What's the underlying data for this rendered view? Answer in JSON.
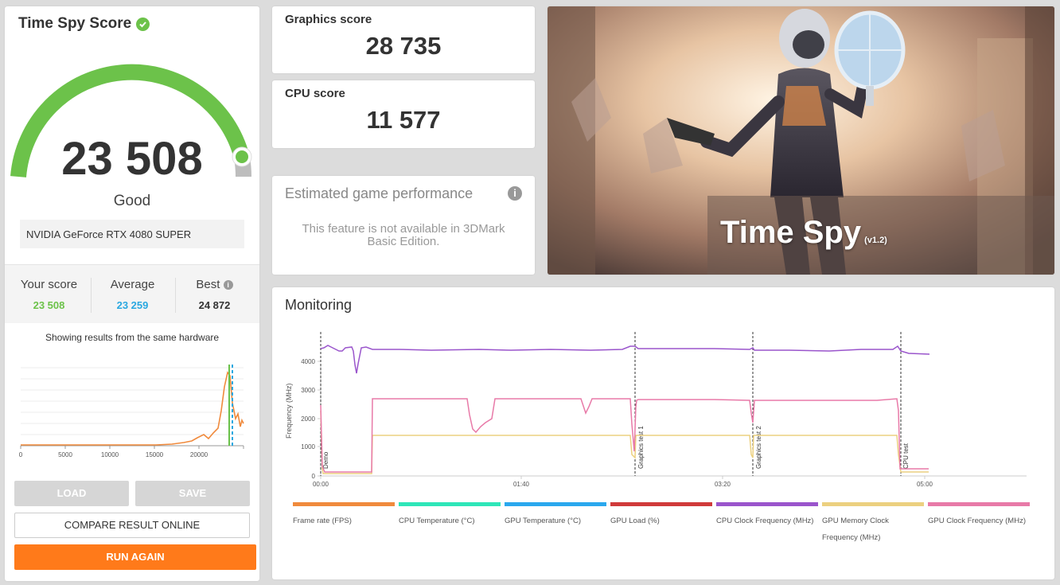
{
  "score_panel": {
    "title": "Time Spy Score",
    "overall_score": "23 508",
    "rating": "Good",
    "gpu_name": "NVIDIA GeForce RTX 4080 SUPER",
    "your_score_label": "Your score",
    "your_score": "23 508",
    "average_label": "Average",
    "average": "23 259",
    "best_label": "Best",
    "best": "24 872",
    "showing_text": "Showing results from the same hardware",
    "gauge_fraction": 0.98,
    "hist_ticks": [
      "0",
      "5000",
      "10000",
      "15000",
      "20000"
    ],
    "load_label": "LOAD",
    "save_label": "SAVE",
    "compare_label": "COMPARE RESULT ONLINE",
    "run_again_label": "RUN AGAIN"
  },
  "graphics": {
    "label": "Graphics score",
    "value": "28 735"
  },
  "cpu": {
    "label": "CPU score",
    "value": "11 577"
  },
  "estimated": {
    "title": "Estimated game performance",
    "message": "This feature is not available in 3DMark Basic Edition."
  },
  "hero": {
    "title": "Time Spy",
    "version": "(v1.2)"
  },
  "monitoring": {
    "title": "Monitoring",
    "y_axis_label": "Frequency (MHz)",
    "y_ticks": [
      "0",
      "1000",
      "2000",
      "3000",
      "4000"
    ],
    "x_ticks": [
      "00:00",
      "01:40",
      "03:20",
      "05:00"
    ],
    "markers": [
      "Demo",
      "Graphics test 1",
      "Graphics test 2",
      "CPU test"
    ],
    "legend": [
      {
        "label": "Frame rate (FPS)",
        "color": "#f08a3c"
      },
      {
        "label": "CPU Temperature (°C)",
        "color": "#2ee6b8"
      },
      {
        "label": "GPU Temperature (°C)",
        "color": "#2aa8ee"
      },
      {
        "label": "GPU Load (%)",
        "color": "#d03a3a"
      },
      {
        "label": "CPU Clock Frequency (MHz)",
        "color": "#9a55cc"
      },
      {
        "label": "GPU Memory Clock Frequency (MHz)",
        "color": "#ecd080"
      },
      {
        "label": "GPU Clock Frequency (MHz)",
        "color": "#e87aa8"
      }
    ]
  },
  "colors": {
    "accent": "#ff7a1a",
    "good_green": "#6cc24a",
    "average_blue": "#2aa8e0"
  }
}
